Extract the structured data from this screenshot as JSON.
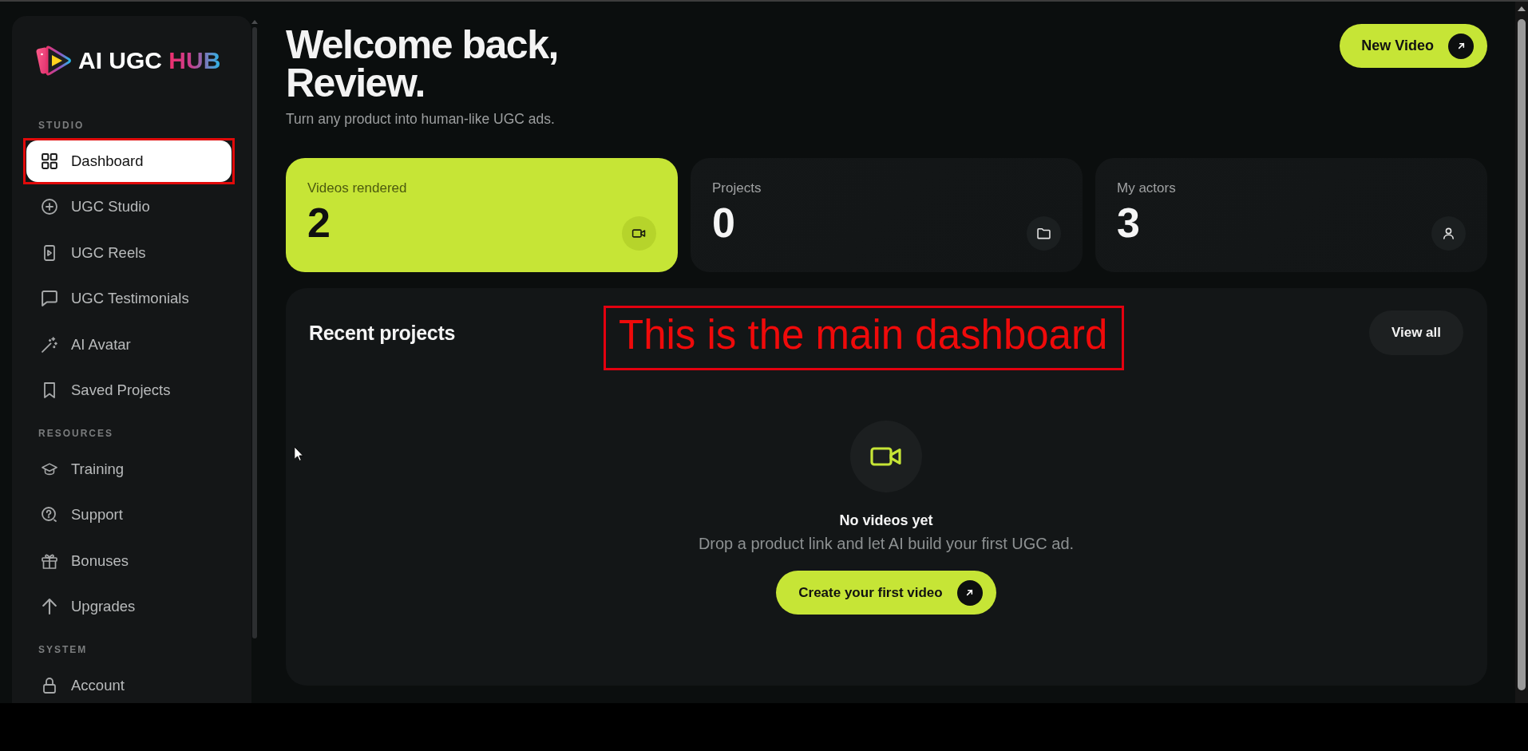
{
  "sidebar": {
    "logo": {
      "name": "AI UGC",
      "accent": "HUB"
    },
    "sections": [
      {
        "title": "STUDIO",
        "items": [
          {
            "label": "Dashboard",
            "selected": true,
            "outlined": true
          },
          {
            "label": "UGC Studio",
            "selected": false,
            "outlined": false
          },
          {
            "label": "UGC Reels",
            "selected": false,
            "outlined": false
          },
          {
            "label": "UGC Testimonials",
            "selected": false,
            "outlined": false
          },
          {
            "label": "AI Avatar",
            "selected": false,
            "outlined": false
          },
          {
            "label": "Saved Projects",
            "selected": false,
            "outlined": false
          }
        ]
      },
      {
        "title": "RESOURCES",
        "items": [
          {
            "label": "Training",
            "selected": false,
            "outlined": false
          },
          {
            "label": "Support",
            "selected": false,
            "outlined": false
          },
          {
            "label": "Bonuses",
            "selected": false,
            "outlined": false
          },
          {
            "label": "Upgrades",
            "selected": false,
            "outlined": false
          }
        ]
      },
      {
        "title": "SYSTEM",
        "items": [
          {
            "label": "Account",
            "selected": false,
            "outlined": false
          }
        ]
      }
    ]
  },
  "header": {
    "title_lines": [
      "Welcome back,",
      "Review."
    ],
    "subtitle": "Turn any product into human-like UGC ads.",
    "new_video_button": "New Video"
  },
  "stats": [
    {
      "label": "Videos rendered",
      "value": "2",
      "highlighted": true
    },
    {
      "label": "Projects",
      "value": "0",
      "highlighted": false
    },
    {
      "label": "My actors",
      "value": "3",
      "highlighted": false
    }
  ],
  "recent_projects": {
    "title": "Recent projects",
    "view_all_button": "View all",
    "empty_state": {
      "title": "No videos yet",
      "message": "Drop a product link and let AI build your first UGC ad.",
      "button": "Create your first video"
    }
  },
  "annotation": {
    "text": "This is the main dashboard"
  }
}
